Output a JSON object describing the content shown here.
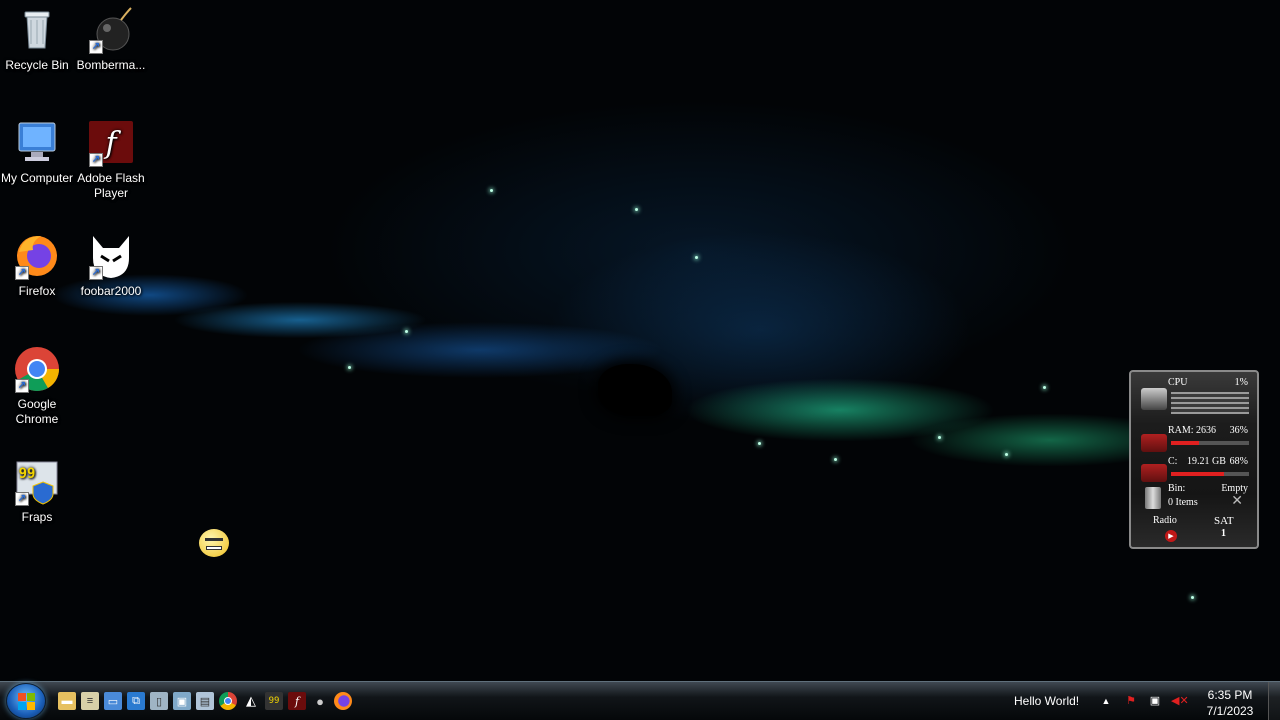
{
  "desktop": {
    "icons": [
      {
        "label": "Recycle Bin",
        "icon": "recycle-bin-icon"
      },
      {
        "label": "Bomberma...",
        "icon": "bomb-icon"
      },
      {
        "label": "My Computer",
        "icon": "computer-icon"
      },
      {
        "label": "Adobe Flash Player",
        "icon": "flash-icon"
      },
      {
        "label": "Firefox",
        "icon": "firefox-icon"
      },
      {
        "label": "foobar2000",
        "icon": "foobar-icon"
      },
      {
        "label": "Google Chrome",
        "icon": "chrome-icon"
      },
      {
        "label": "Fraps",
        "icon": "fraps-icon"
      }
    ]
  },
  "gadget": {
    "cpu_label": "CPU",
    "cpu_value": "1%",
    "ram_label": "RAM: 2636",
    "ram_value": "36%",
    "ram_fraction": 0.36,
    "disk_label": "C:",
    "disk_size": "19.21 GB",
    "disk_value": "68%",
    "disk_fraction": 0.68,
    "bin_label": "Bin:",
    "bin_status": "Empty",
    "bin_items": "0 Items",
    "radio_label": "Radio",
    "day": "SAT",
    "date": "1"
  },
  "taskbar": {
    "greeting": "Hello World!",
    "time": "6:35 PM",
    "date": "7/1/2023",
    "pinned": [
      "folder-icon",
      "documents-icon",
      "computer-icon",
      "network-icon",
      "recycle-bin-icon",
      "control-panel-icon",
      "chrome-icon",
      "foobar-icon",
      "fraps-icon",
      "flash-icon",
      "bomb-icon",
      "firefox-icon"
    ]
  }
}
